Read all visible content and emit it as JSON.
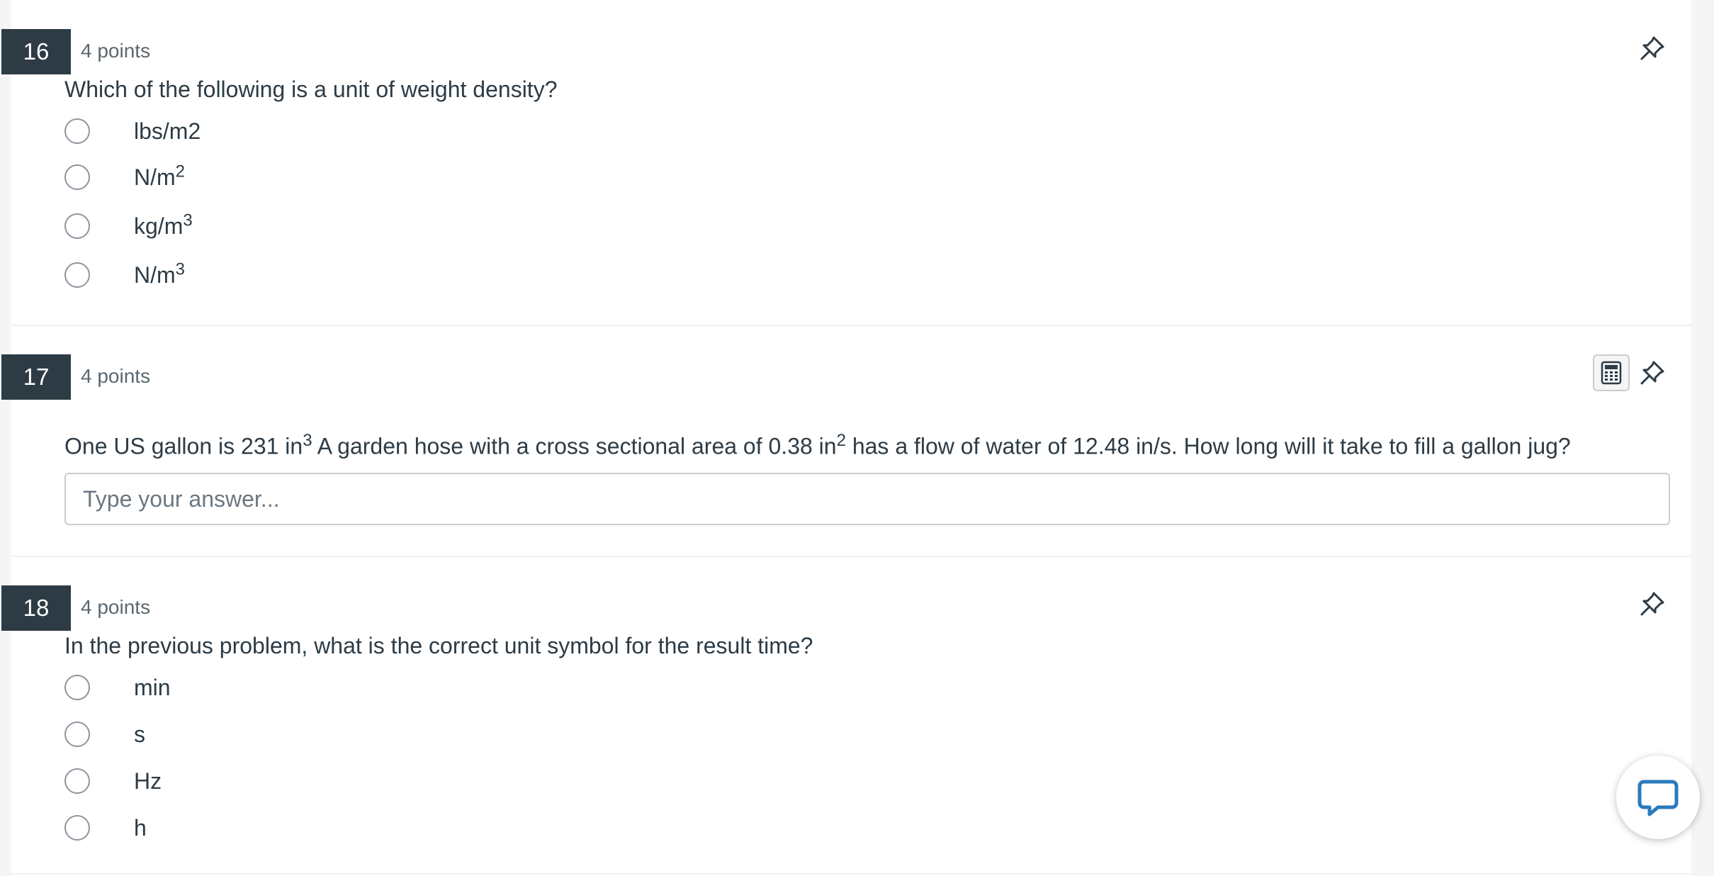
{
  "questions": [
    {
      "number": "16",
      "points": "4 points",
      "text": "Which of the following is a unit of weight density?",
      "options": [
        {
          "base": "lbs/m2",
          "sup": ""
        },
        {
          "base": "N/m",
          "sup": "2"
        },
        {
          "base": "kg/m",
          "sup": "3"
        },
        {
          "base": "N/m",
          "sup": "3"
        }
      ]
    },
    {
      "number": "17",
      "points": "4 points",
      "text_part1": "One US gallon is 231 in",
      "text_sup1": "3",
      "text_part2": " A garden hose with a cross sectional area of 0.38 in",
      "text_sup2": "2",
      "text_part3": " has a flow of water of 12.48 in/s. How long will it take to fill a gallon jug?",
      "answer_placeholder": "Type your answer...",
      "answer_value": ""
    },
    {
      "number": "18",
      "points": "4 points",
      "text": "In the previous problem, what is the correct unit symbol for the result time?",
      "options": [
        {
          "base": "min",
          "sup": ""
        },
        {
          "base": "s",
          "sup": ""
        },
        {
          "base": "Hz",
          "sup": ""
        },
        {
          "base": "h",
          "sup": ""
        }
      ]
    }
  ],
  "icons": {
    "pin": "pin-icon",
    "calculator": "calculator-icon",
    "chat": "chat-icon"
  },
  "colors": {
    "question_number_bg": "#2d3b45",
    "text": "#2d3b45",
    "chat_accent": "#2b7abc"
  }
}
